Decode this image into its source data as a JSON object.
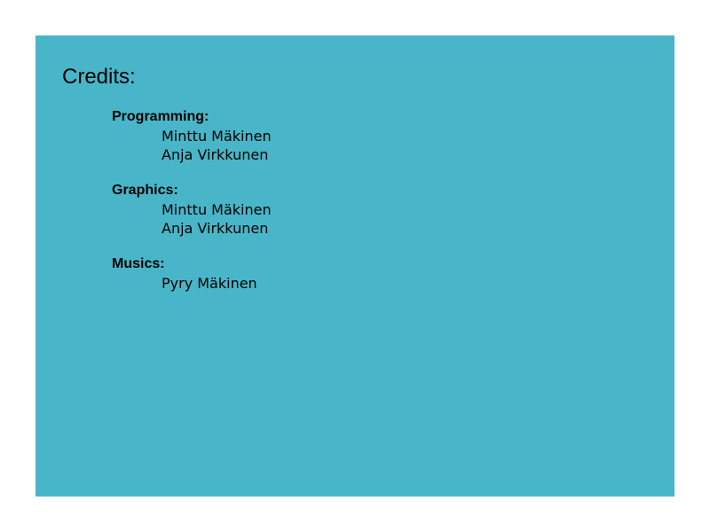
{
  "credits": {
    "title": "Credits:",
    "sections": [
      {
        "heading": "Programming:",
        "names": [
          "Minttu Mäkinen",
          "Anja Virkkunen"
        ]
      },
      {
        "heading": "Graphics:",
        "names": [
          "Minttu Mäkinen",
          "Anja Virkkunen"
        ]
      },
      {
        "heading": "Musics:",
        "names": [
          "Pyry Mäkinen"
        ]
      }
    ]
  },
  "colors": {
    "background": "#48b6c8",
    "text": "#000000",
    "page": "#ffffff"
  }
}
